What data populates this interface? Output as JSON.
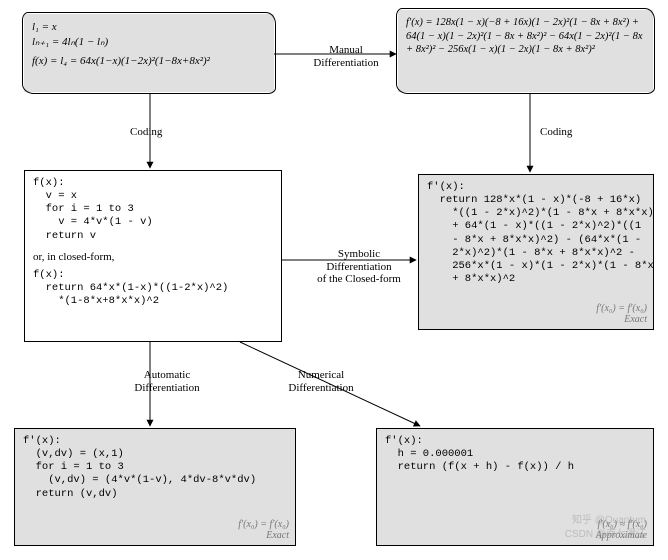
{
  "boxes": {
    "defn": {
      "l1": "l₁ = x",
      "ln1": "lₙ₊₁ = 4lₙ(1 − lₙ)",
      "fx": "f(x) = l₄ = 64x(1−x)(1−2x)²(1−8x+8x²)²"
    },
    "manual_deriv": {
      "text": "f′(x) = 128x(1 − x)(−8 + 16x)(1 − 2x)²(1 − 8x + 8x²) + 64(1 − x)(1 − 2x)²(1 − 8x + 8x²)² − 64x(1 − 2x)²(1 − 8x + 8x²)² − 256x(1 − x)(1 − 2x)(1 − 8x + 8x²)²"
    },
    "code_fx": {
      "line1": "f(x):",
      "line2": "  v = x",
      "line3": "  for i = 1 to 3",
      "line4": "    v = 4*v*(1 - v)",
      "line5": "  return v",
      "sep": "or, in closed-form,",
      "line6": "f(x):",
      "line7": "  return 64*x*(1-x)*((1-2*x)^2)",
      "line8": "    *(1-8*x+8*x*x)^2"
    },
    "code_fprime": {
      "line1": "f'(x):",
      "line2": "  return 128*x*(1 - x)*(-8 + 16*x)",
      "line3": "    *((1 - 2*x)^2)*(1 - 8*x + 8*x*x)",
      "line4": "    + 64*(1 - x)*((1 - 2*x)^2)*((1",
      "line5": "    - 8*x + 8*x*x)^2) - (64*x*(1 -",
      "line6": "    2*x)^2)*(1 - 8*x + 8*x*x)^2 -",
      "line7": "    256*x*(1 - x)*(1 - 2*x)*(1 - 8*x",
      "line8": "    + 8*x*x)^2",
      "note1": "f'(x₀) = f′(x₀)",
      "note2": "Exact"
    },
    "autodiff": {
      "line1": "f'(x):",
      "line2": "  (v,dv) = (x,1)",
      "line3": "  for i = 1 to 3",
      "line4": "    (v,dv) = (4*v*(1-v), 4*dv-8*v*dv)",
      "line5": "  return (v,dv)",
      "note1": "f'(x₀) = f′(x₀)",
      "note2": "Exact"
    },
    "numdiff": {
      "line1": "f'(x):",
      "line2": "  h = 0.000001",
      "line3": "  return (f(x + h) - f(x)) / h",
      "note1": "f'(x₀) ≈ f′(x₀)",
      "note2": "Approximate"
    }
  },
  "edges": {
    "manual": "Manual\nDifferentiation",
    "coding_left": "Coding",
    "coding_right": "Coding",
    "symbolic": "Symbolic\nDifferentiation\nof the Closed-form",
    "autodiff": "Automatic\nDifferentiation",
    "numdiff": "Numerical\nDifferentiation"
  },
  "watermarks": {
    "w1": "知乎 @Quantum",
    "w2": "CSDN @南七澄江"
  }
}
